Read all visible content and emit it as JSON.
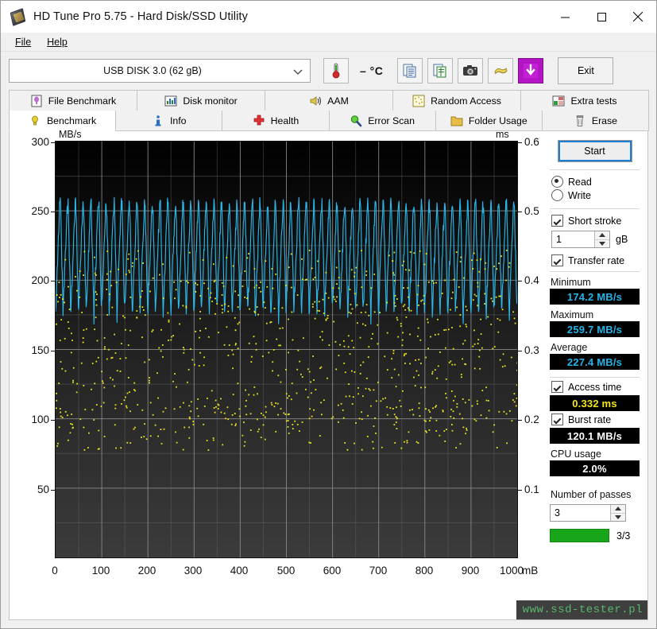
{
  "window": {
    "title": "HD Tune Pro 5.75 - Hard Disk/SSD Utility",
    "minimize_label": "Minimize",
    "maximize_label": "Maximize",
    "close_label": "Close"
  },
  "menu": {
    "items": [
      {
        "label": "File"
      },
      {
        "label": "Help"
      }
    ]
  },
  "toolbar": {
    "drive": "USB DISK 3.0 (62 gB)",
    "temperature": "–  °C",
    "buttons": [
      {
        "name": "copy-text-icon",
        "tooltip": "Copy to clipboard"
      },
      {
        "name": "copy-excel-icon",
        "tooltip": "Copy to Excel"
      },
      {
        "name": "screenshot-icon",
        "tooltip": "Screenshot"
      },
      {
        "name": "options-icon",
        "tooltip": "Options"
      },
      {
        "name": "download-icon",
        "tooltip": "Save"
      }
    ],
    "exit_label": "Exit"
  },
  "tabs": {
    "row1": [
      {
        "label": "File Benchmark",
        "icon": "file-benchmark-icon",
        "active": false
      },
      {
        "label": "Disk monitor",
        "icon": "disk-monitor-icon",
        "active": false
      },
      {
        "label": "AAM",
        "icon": "aam-icon",
        "active": false
      },
      {
        "label": "Random Access",
        "icon": "random-access-icon",
        "active": false
      },
      {
        "label": "Extra tests",
        "icon": "extra-tests-icon",
        "active": false
      }
    ],
    "row2": [
      {
        "label": "Benchmark",
        "icon": "benchmark-icon",
        "active": true
      },
      {
        "label": "Info",
        "icon": "info-icon",
        "active": false
      },
      {
        "label": "Health",
        "icon": "health-icon",
        "active": false
      },
      {
        "label": "Error Scan",
        "icon": "error-scan-icon",
        "active": false
      },
      {
        "label": "Folder Usage",
        "icon": "folder-usage-icon",
        "active": false
      },
      {
        "label": "Erase",
        "icon": "erase-icon",
        "active": false
      }
    ]
  },
  "panel": {
    "start_label": "Start",
    "mode": {
      "read_label": "Read",
      "write_label": "Write",
      "selected": "Read"
    },
    "short_stroke": {
      "label": "Short stroke",
      "checked": true,
      "value": "1",
      "unit": "gB"
    },
    "transfer_rate": {
      "label": "Transfer rate",
      "checked": true
    },
    "minimum": {
      "label": "Minimum",
      "value": "174.2 MB/s"
    },
    "maximum": {
      "label": "Maximum",
      "value": "259.7 MB/s"
    },
    "average": {
      "label": "Average",
      "value": "227.4 MB/s"
    },
    "access_time": {
      "label": "Access time",
      "checked": true,
      "value": "0.332 ms"
    },
    "burst_rate": {
      "label": "Burst rate",
      "checked": true,
      "value": "120.1 MB/s"
    },
    "cpu_usage": {
      "label": "CPU usage",
      "value": "2.0%"
    },
    "passes": {
      "label": "Number of passes",
      "value": "3",
      "progress_text": "3/3",
      "progress_percent": 100
    }
  },
  "watermark": "www.ssd-tester.pl",
  "chart_data": {
    "type": "line",
    "title": "",
    "xlabel": "mB",
    "ylabel": "MB/s",
    "y2label": "ms",
    "xlim": [
      0,
      1000
    ],
    "ylim": [
      0,
      300
    ],
    "y2lim": [
      0,
      0.6
    ],
    "grid": true,
    "xticks": [
      0,
      100,
      200,
      300,
      400,
      500,
      600,
      700,
      800,
      900,
      1000
    ],
    "yticks": [
      50,
      100,
      150,
      200,
      250,
      300
    ],
    "y2ticks": [
      0.1,
      0.2,
      0.3,
      0.4,
      0.5,
      0.6
    ],
    "legend": "none",
    "series": [
      {
        "name": "Transfer rate",
        "color": "#29b6e8",
        "axis": "left",
        "unit": "MB/s",
        "style": "line",
        "range": [
          174.2,
          259.7
        ],
        "mean": 227.4,
        "description": "Dense saw-tooth oscillation between ~185 and ~258 MB/s across the full 0-1000 mB span, roughly 60 cycles"
      },
      {
        "name": "Access time",
        "color": "#e8e420",
        "axis": "right",
        "unit": "ms",
        "style": "scatter",
        "mean": 0.332,
        "range": [
          0.22,
          0.38
        ],
        "description": "Yellow scattered dots concentrated between 0.24 and 0.36 ms across the full span"
      }
    ]
  }
}
